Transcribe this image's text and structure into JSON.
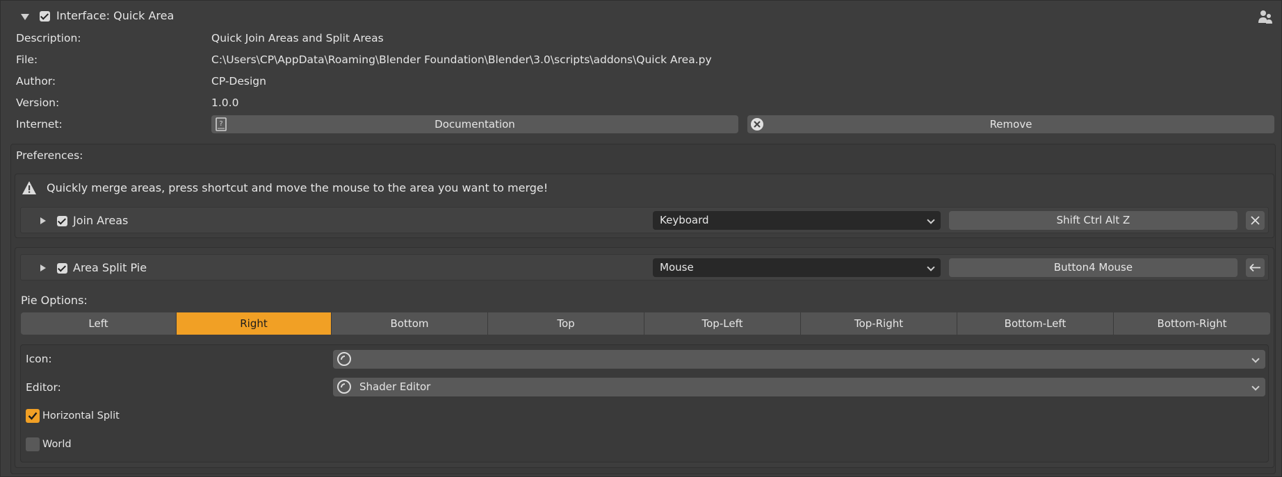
{
  "addon": {
    "header_label": "Interface: Quick Area",
    "enabled": true,
    "info": [
      {
        "label": "Description:",
        "value": "Quick Join Areas and Split Areas"
      },
      {
        "label": "File:",
        "value": "C:\\Users\\CP\\AppData\\Roaming\\Blender Foundation\\Blender\\3.0\\scripts\\addons\\Quick Area.py"
      },
      {
        "label": "Author:",
        "value": "CP-Design"
      },
      {
        "label": "Version:",
        "value": "1.0.0"
      }
    ],
    "internet_label": "Internet:",
    "documentation_label": "Documentation",
    "remove_label": "Remove"
  },
  "preferences": {
    "title": "Preferences:",
    "warning_text": "Quickly merge areas, press shortcut and move the mouse to the area you want to merge!",
    "join_areas": {
      "label": "Join Areas",
      "enabled": true,
      "input_type": "Keyboard",
      "shortcut": "Shift Ctrl Alt Z"
    },
    "area_split_pie": {
      "label": "Area Split Pie",
      "enabled": true,
      "input_type": "Mouse",
      "shortcut": "Button4 Mouse"
    },
    "pie_options_label": "Pie Options:",
    "pie_tabs": [
      "Left",
      "Right",
      "Bottom",
      "Top",
      "Top-Left",
      "Top-Right",
      "Bottom-Left",
      "Bottom-Right"
    ],
    "pie_active_tab": "Right",
    "icon_label": "Icon:",
    "icon_value": "",
    "editor_label": "Editor:",
    "editor_value": "Shader Editor",
    "horizontal_split": {
      "label": "Horizontal Split",
      "checked": true
    },
    "world": {
      "label": "World",
      "checked": false
    }
  },
  "colors": {
    "accent": "#f1a025",
    "background": "#3d3d3d",
    "button": "#595959",
    "field": "#282828"
  }
}
